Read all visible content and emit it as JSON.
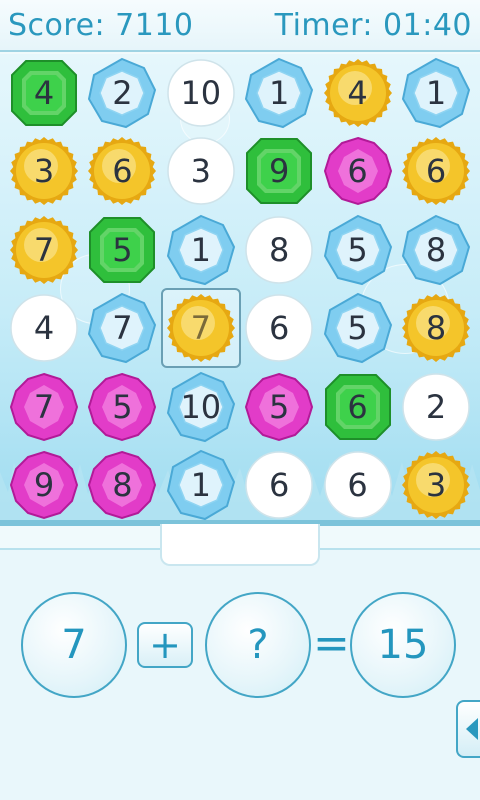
{
  "header": {
    "score_text": "Score: 7110",
    "timer_text": "Timer: 01:40"
  },
  "colors": {
    "green": "#2fbf3c",
    "blue": "#7fcdf0",
    "white": "#ffffff",
    "gold": "#f4c52a",
    "magenta": "#e23cc8",
    "accent": "#2a98be"
  },
  "board": {
    "selected": {
      "row": 3,
      "col": 2
    },
    "rows": [
      [
        {
          "type": "green",
          "value": "4"
        },
        {
          "type": "blue",
          "value": "2"
        },
        {
          "type": "white",
          "value": "10"
        },
        {
          "type": "blue",
          "value": "1"
        },
        {
          "type": "gold",
          "value": "4"
        },
        {
          "type": "blue",
          "value": "1"
        }
      ],
      [
        {
          "type": "gold",
          "value": "3"
        },
        {
          "type": "gold",
          "value": "6"
        },
        {
          "type": "white",
          "value": "3"
        },
        {
          "type": "green",
          "value": "9"
        },
        {
          "type": "magenta",
          "value": "6"
        },
        {
          "type": "gold",
          "value": "6"
        }
      ],
      [
        {
          "type": "gold",
          "value": "7"
        },
        {
          "type": "green",
          "value": "5"
        },
        {
          "type": "blue",
          "value": "1"
        },
        {
          "type": "white",
          "value": "8"
        },
        {
          "type": "blue",
          "value": "5"
        },
        {
          "type": "blue",
          "value": "8"
        }
      ],
      [
        {
          "type": "white",
          "value": "4"
        },
        {
          "type": "blue",
          "value": "7"
        },
        {
          "type": "gold",
          "value": "7"
        },
        {
          "type": "white",
          "value": "6"
        },
        {
          "type": "blue",
          "value": "5"
        },
        {
          "type": "gold",
          "value": "8"
        }
      ],
      [
        {
          "type": "magenta",
          "value": "7"
        },
        {
          "type": "magenta",
          "value": "5"
        },
        {
          "type": "blue",
          "value": "10"
        },
        {
          "type": "magenta",
          "value": "5"
        },
        {
          "type": "green",
          "value": "6"
        },
        {
          "type": "white",
          "value": "2"
        }
      ],
      [
        {
          "type": "magenta",
          "value": "9"
        },
        {
          "type": "magenta",
          "value": "8"
        },
        {
          "type": "blue",
          "value": "1"
        },
        {
          "type": "white",
          "value": "6"
        },
        {
          "type": "white",
          "value": "6"
        },
        {
          "type": "gold",
          "value": "3"
        }
      ]
    ]
  },
  "equation": {
    "left": "7",
    "operator": "+",
    "unknown": "?",
    "equals": "=",
    "result": "15"
  },
  "side_button_icon": "triangle-left-icon"
}
